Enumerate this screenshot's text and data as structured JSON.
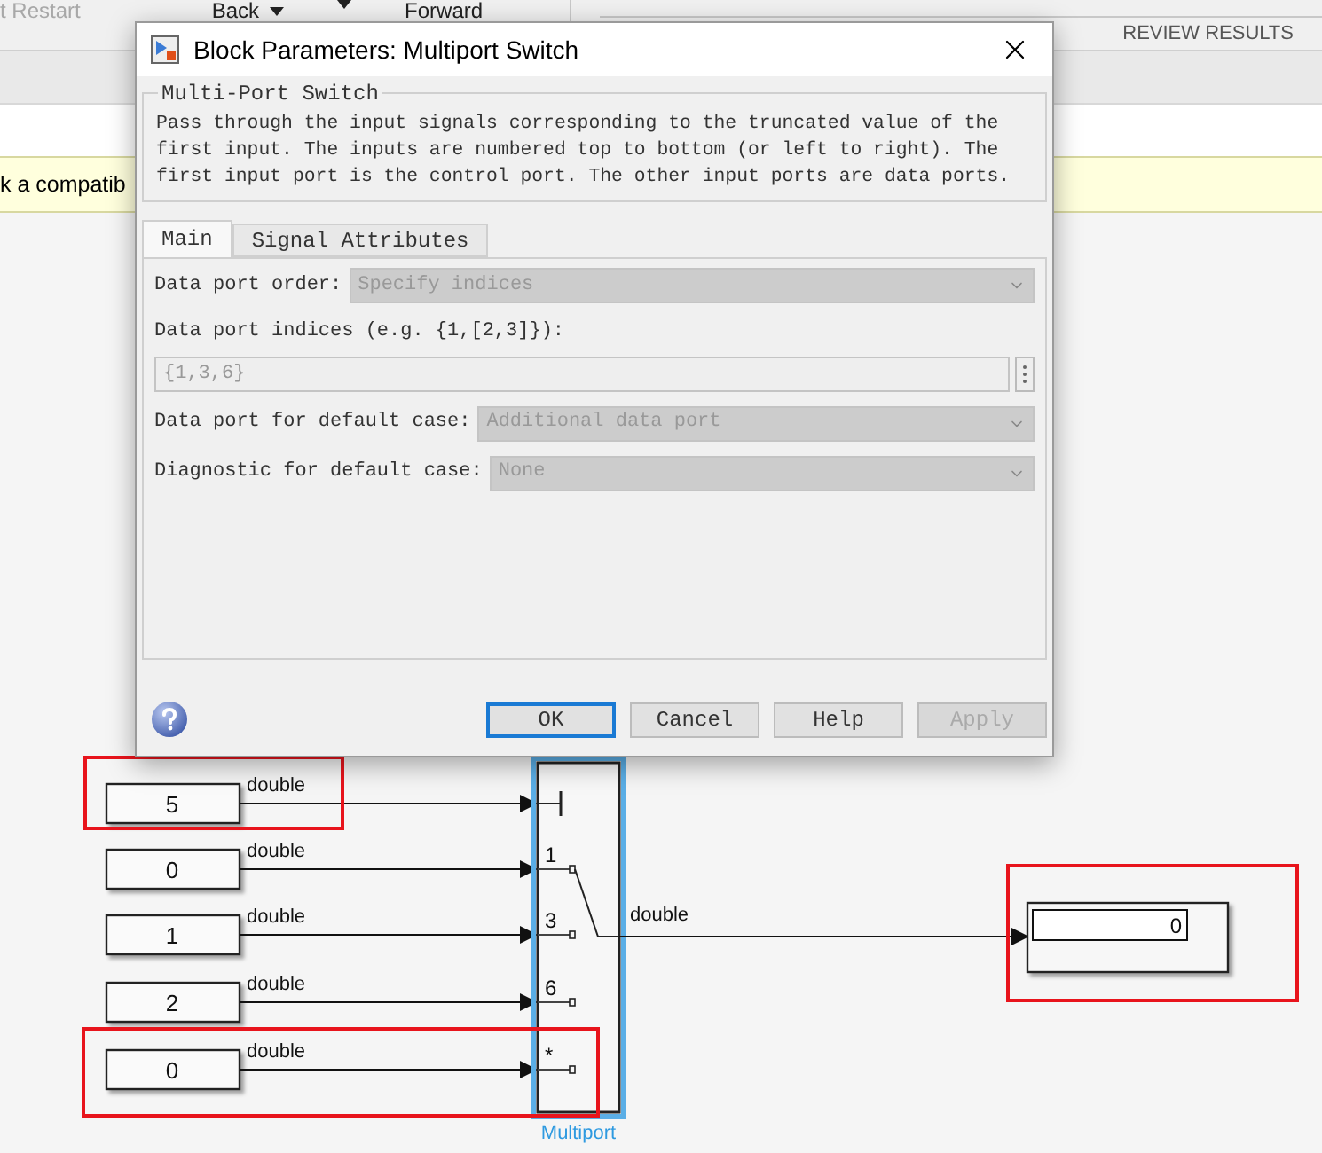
{
  "toolbar": {
    "items": [
      {
        "label": "t Restart",
        "disabled": true,
        "caret": false
      },
      {
        "label": "Back",
        "disabled": false,
        "caret": true
      },
      {
        "disabled": false,
        "caret": true
      },
      {
        "label": "Forward",
        "disabled": false,
        "caret": false
      }
    ],
    "section": "REVIEW RESULTS"
  },
  "banner": {
    "text": "k a compatib"
  },
  "dialog": {
    "title": "Block Parameters: Multiport Switch",
    "group_title": "Multi-Port Switch",
    "description": "Pass through the input signals corresponding to the truncated value of the first input. The inputs are numbered top to bottom (or left to right). The first input port is the control port. The other input ports are data ports.",
    "tabs": [
      {
        "label": "Main",
        "selected": true
      },
      {
        "label": "Signal Attributes",
        "selected": false
      }
    ],
    "parameters": [
      {
        "kind": "dropdown",
        "label": "Data port order:",
        "value": "Specify indices",
        "disabled": true
      },
      {
        "kind": "text",
        "label": "Data port indices (e.g. {1,[2,3]}):",
        "value": "{1,3,6}",
        "disabled": true
      },
      {
        "kind": "dropdown",
        "label": "Data port for default case:",
        "value": "Additional data port",
        "disabled": true
      },
      {
        "kind": "dropdown",
        "label": "Diagnostic for default case:",
        "value": "None",
        "disabled": true
      }
    ],
    "buttons": [
      {
        "label": "OK",
        "focused": true,
        "disabled": false
      },
      {
        "label": "Cancel",
        "focused": false,
        "disabled": false
      },
      {
        "label": "Help",
        "focused": false,
        "disabled": false
      },
      {
        "label": "Apply",
        "focused": false,
        "disabled": true
      }
    ]
  },
  "diagram": {
    "inputs": [
      {
        "value": "5",
        "signal": "double",
        "highlighted": true
      },
      {
        "value": "0",
        "signal": "double",
        "highlighted": false
      },
      {
        "value": "1",
        "signal": "double",
        "highlighted": false
      },
      {
        "value": "2",
        "signal": "double",
        "highlighted": false
      },
      {
        "value": "0",
        "signal": "double",
        "highlighted": true
      }
    ],
    "switch": {
      "ports": [
        "1",
        "3",
        "6",
        "*"
      ],
      "name": "Multiport",
      "selected": true
    },
    "output_signal": "double",
    "display": {
      "value": "0",
      "highlighted": true
    }
  }
}
